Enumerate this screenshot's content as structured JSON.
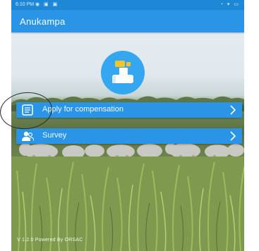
{
  "status_bar": {
    "time": "6:10 PM",
    "left_icons": "◉ ▣ ▣",
    "right_icons": "◔ ▾ ▭"
  },
  "app_bar": {
    "title": "Anukampa"
  },
  "logo": {
    "icon": "hand-coin-icon",
    "color": "#34a7f0"
  },
  "menu": {
    "items": [
      {
        "label": "Apply for compensation",
        "icon": "document-list-icon"
      },
      {
        "label": "Survey",
        "icon": "survey-people-icon"
      }
    ]
  },
  "footer": {
    "text": "V 1.2.0 Powered By ORSAC"
  },
  "colors": {
    "primary": "#2a95e6",
    "status_bar": "#1e87d6"
  }
}
